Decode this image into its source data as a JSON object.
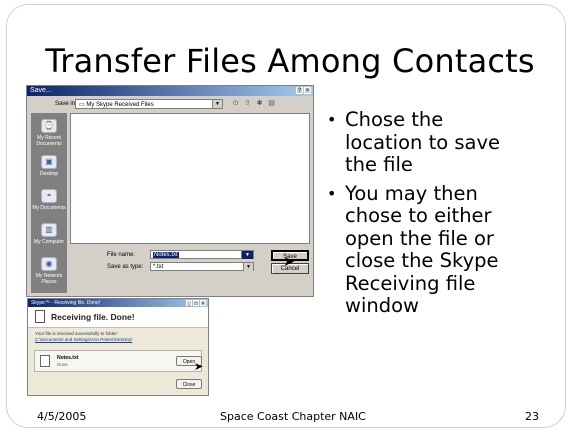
{
  "slide": {
    "title": "Transfer Files Among Contacts",
    "bullets": [
      "Chose the location to save the file",
      "You may then chose to either open the file or close the Skype Receiving file window"
    ],
    "footer": {
      "date": "4/5/2005",
      "center": "Space Coast Chapter NAIC",
      "page": "23"
    }
  },
  "save_dialog": {
    "title": "Save...",
    "save_in_label": "Save in:",
    "save_in_value": "My Skype Received Files",
    "places": [
      "My Recent Documents",
      "Desktop",
      "My Documents",
      "My Computer",
      "My Network Places"
    ],
    "file_name_label": "File name:",
    "file_name_value": "Notes.txt",
    "save_as_type_label": "Save as type:",
    "save_as_type_value": "*.txt",
    "save_button": "Save",
    "cancel_button": "Cancel"
  },
  "receive_dialog": {
    "title": "Skype™ - Receiving file. Done!",
    "heading": "Receiving file. Done!",
    "message": "Your file is received successfully to folder:",
    "folder_link": "C:\\Documents and Settings\\Ann Peters\\Desktop\\",
    "file_name": "Notes.txt",
    "file_size": "Done",
    "open_button": "Open",
    "close_button": "Close"
  }
}
